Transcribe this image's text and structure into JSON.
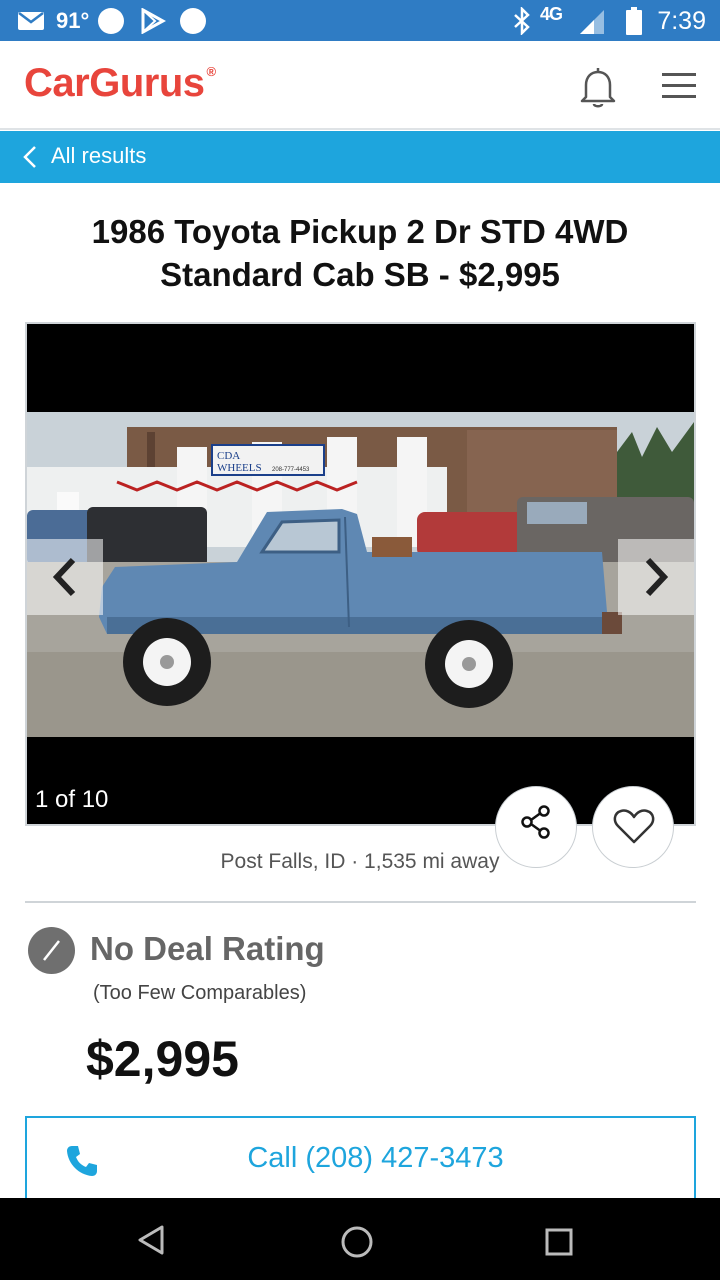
{
  "status_bar": {
    "temperature": "91°",
    "network": "4G",
    "time": "7:39",
    "icons": [
      "mail-icon",
      "circle-icon",
      "play-store-icon",
      "circle-icon",
      "bluetooth-icon",
      "signal-icon",
      "battery-icon"
    ]
  },
  "header": {
    "logo_text": "CarGurus",
    "logo_mark": "®",
    "icons": [
      "bell-icon",
      "hamburger-menu-icon"
    ]
  },
  "back_bar": {
    "label": "All results"
  },
  "listing": {
    "title": "1986 Toyota Pickup 2 Dr STD 4WD Standard Cab SB - $2,995",
    "photo_counter": "1 of 10",
    "location": "Post Falls, ID · 1,535 mi away",
    "deal_rating": "No Deal Rating",
    "deal_note": "(Too Few Comparables)",
    "price": "$2,995"
  },
  "photo": {
    "sign_line1": "CDA",
    "sign_line2": "WHEELS",
    "sign_phone": "208-777-4453"
  },
  "actions": {
    "call_label": "Call (208) 427-3473"
  },
  "colors": {
    "status_bar": "#2f7cc4",
    "brand_red": "#e8453c",
    "accent_blue": "#1ea5dd",
    "deal_gray": "#6f6f6f"
  }
}
